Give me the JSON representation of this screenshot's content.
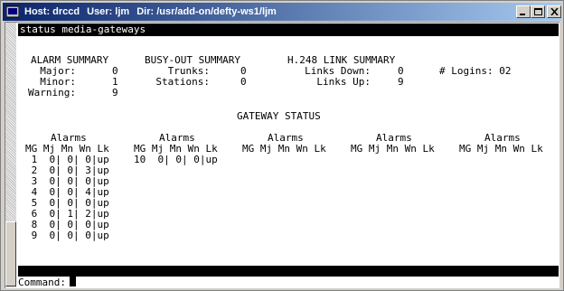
{
  "window": {
    "title_host": "Host: drccd",
    "title_user": "User: ljm",
    "title_dir": "Dir: /usr/add-on/defty-ws1/ljm"
  },
  "terminal": {
    "command_line": "status media-gateways",
    "alarm_summary": {
      "heading": "ALARM SUMMARY",
      "major_label": "Major:",
      "major": "0",
      "minor_label": "Minor:",
      "minor": "1",
      "warning_label": "Warning:",
      "warning": "9"
    },
    "busyout_summary": {
      "heading": "BUSY-OUT SUMMARY",
      "trunks_label": "Trunks:",
      "trunks": "0",
      "stations_label": "Stations:",
      "stations": "0"
    },
    "link_summary": {
      "heading": "H.248 LINK SUMMARY",
      "down_label": "Links Down:",
      "down": "0",
      "up_label": "Links Up:",
      "up": "9"
    },
    "logins": "# Logins: 02",
    "gateway_status_heading": "GATEWAY STATUS",
    "alarms_label": "Alarms",
    "col_header": "MG Mj Mn Wn Lk",
    "rows_col1": [
      " 1  0| 0| 0|up",
      " 2  0| 0| 3|up",
      " 3  0| 0| 0|up",
      " 4  0| 0| 4|up",
      " 5  0| 0| 0|up",
      " 6  0| 1| 2|up",
      " 8  0| 0| 0|up",
      " 9  0| 0| 0|up"
    ],
    "rows_col2": [
      "10  0| 0| 0|up"
    ],
    "command_prompt": "Command:"
  }
}
